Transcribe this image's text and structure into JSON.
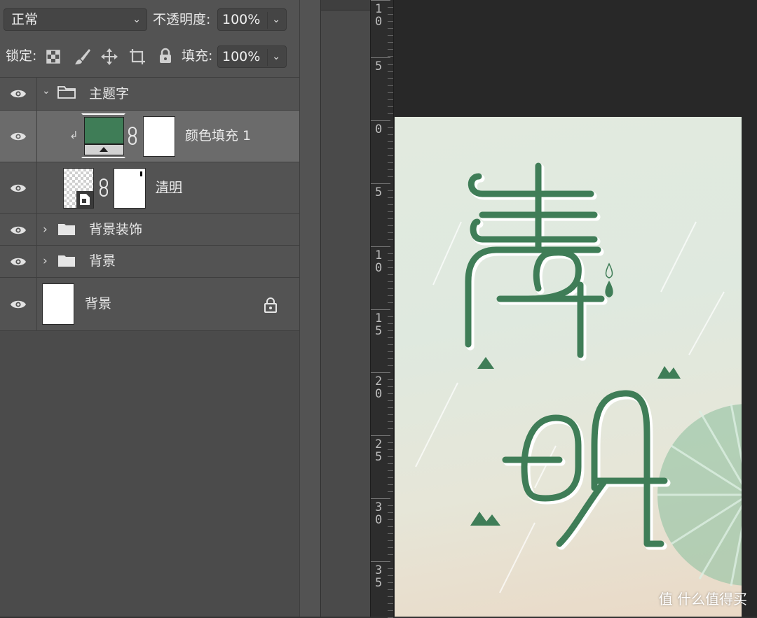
{
  "toolbar": {
    "blend_mode": "正常",
    "opacity_label": "不透明度:",
    "opacity_value": "100%",
    "lock_label": "锁定:",
    "fill_label": "填充:",
    "fill_value": "100%",
    "lock_icons": [
      "lock-transparent-pixels-icon",
      "lock-image-pixels-icon",
      "lock-position-icon",
      "lock-artboard-icon",
      "lock-all-icon"
    ]
  },
  "layers": [
    {
      "name": "主题字",
      "type": "group",
      "expanded": true
    },
    {
      "name": "颜色填充 1",
      "type": "fill",
      "selected": true,
      "color": "#3f7d57"
    },
    {
      "name": "清明",
      "type": "smart-object"
    },
    {
      "name": "背景装饰",
      "type": "group",
      "expanded": false
    },
    {
      "name": "背景",
      "type": "group",
      "expanded": false
    },
    {
      "name": "背景",
      "type": "background",
      "locked": true
    }
  ],
  "ruler": {
    "labels": [
      [
        "1",
        "0"
      ],
      [
        "5"
      ],
      [
        "0"
      ],
      [
        "5"
      ],
      [
        "1",
        "0"
      ],
      [
        "1",
        "5"
      ],
      [
        "2",
        "0"
      ],
      [
        "2",
        "5"
      ],
      [
        "3",
        "0"
      ],
      [
        "3",
        "5"
      ]
    ]
  },
  "canvas": {
    "accent_color": "#3f7d57",
    "background_color": "#e2eadf"
  },
  "watermark": "值 什么值得买"
}
